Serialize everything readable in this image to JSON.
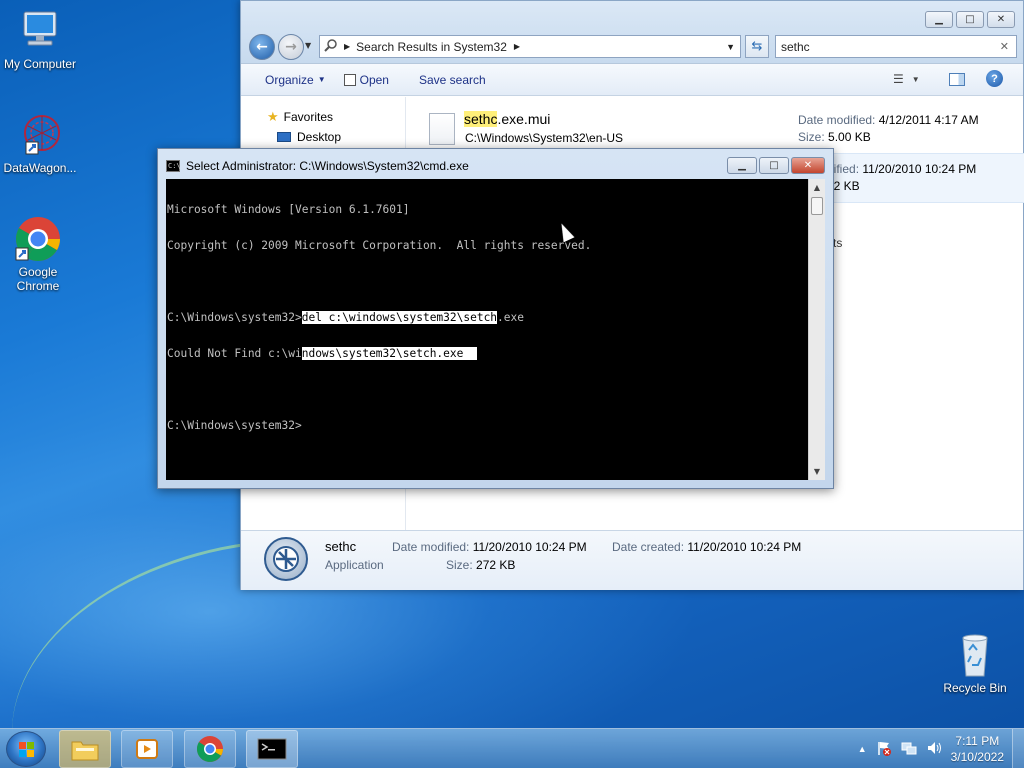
{
  "desktop": {
    "icons": [
      {
        "label": "My Computer"
      },
      {
        "label": "DataWagon..."
      },
      {
        "label": "Google Chrome"
      },
      {
        "label": "Recycle Bin"
      }
    ]
  },
  "explorer": {
    "address": {
      "location": "Search Results in System32"
    },
    "search": {
      "value": "sethc"
    },
    "toolbar": {
      "organize": "Organize",
      "open": "Open",
      "save_search": "Save search"
    },
    "nav": {
      "favorites": "Favorites",
      "desktop": "Desktop"
    },
    "results": [
      {
        "name_match": "sethc",
        "name_rest": ".exe.mui",
        "path": "C:\\Windows\\System32\\en-US",
        "date_label": "Date modified:",
        "date": "4/12/2011 4:17 AM",
        "size_label": "Size:",
        "size": "5.00 KB"
      },
      {
        "date_partial": "dified:",
        "date": "11/20/2010 10:24 PM",
        "size_partial": "72 KB"
      }
    ],
    "partial_text": "ts",
    "details": {
      "name": "sethc",
      "type": "Application",
      "modified_label": "Date modified:",
      "modified": "11/20/2010 10:24 PM",
      "created_label": "Date created:",
      "created": "11/20/2010 10:24 PM",
      "size_label": "Size:",
      "size": "272 KB"
    }
  },
  "cmd": {
    "title": "Select Administrator: C:\\Windows\\System32\\cmd.exe",
    "lines": {
      "l1": "Microsoft Windows [Version 6.1.7601]",
      "l2": "Copyright (c) 2009 Microsoft Corporation.  All rights reserved.",
      "l4_prompt": "C:\\Windows\\system32>",
      "l4_sel": "del c:\\windows\\system32\\setch",
      "l4_rest": ".exe",
      "l5_pre": "Could Not Find c:\\wi",
      "l5_sel": "ndows\\system32\\setch.exe  ",
      "l7": "C:\\Windows\\system32>"
    }
  },
  "taskbar": {
    "clock_time": "7:11 PM",
    "clock_date": "3/10/2022"
  }
}
